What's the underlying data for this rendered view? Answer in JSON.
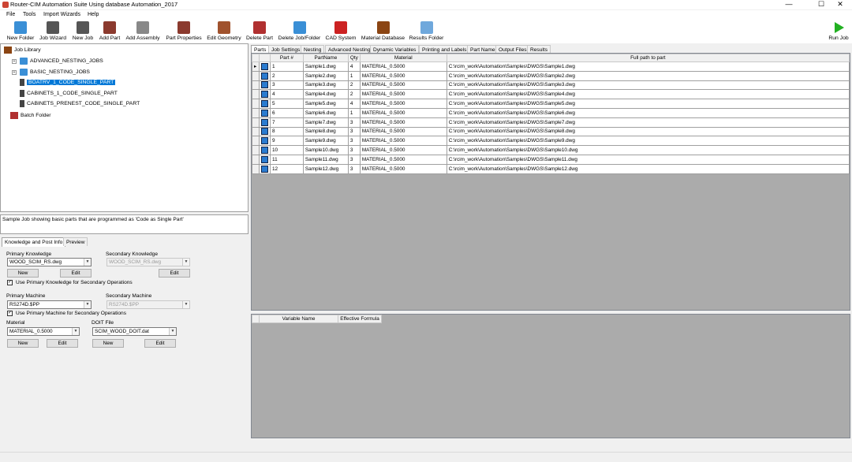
{
  "window": {
    "title": "Router-CIM Automation Suite  Using database Automation_2017",
    "minimize": "—",
    "maximize": "☐",
    "close": "✕"
  },
  "menu": [
    "File",
    "Tools",
    "Import Wizards",
    "Help"
  ],
  "toolbar": {
    "buttons": [
      {
        "label": "New Folder",
        "icon": "new-folder-icon",
        "color": "#3a8fd6"
      },
      {
        "label": "Job Wizard",
        "icon": "job-wizard-icon",
        "color": "#555555"
      },
      {
        "label": "New Job",
        "icon": "new-job-icon",
        "color": "#555555"
      },
      {
        "label": "Add Part",
        "icon": "add-part-icon",
        "color": "#8b3a2e"
      },
      {
        "label": "Add Assembly",
        "icon": "add-assembly-icon",
        "color": "#888888"
      },
      {
        "label": "Part Properties",
        "icon": "part-properties-icon",
        "color": "#8b3a2e"
      },
      {
        "label": "Edit Geometry",
        "icon": "edit-geometry-icon",
        "color": "#a0522d"
      },
      {
        "label": "Delete Part",
        "icon": "delete-part-icon",
        "color": "#b03030"
      },
      {
        "label": "Delete Job/Folder",
        "icon": "delete-job-folder-icon",
        "color": "#3a8fd6"
      },
      {
        "label": "CAD System",
        "icon": "cad-system-icon",
        "color": "#cc2222"
      },
      {
        "label": "Material Database",
        "icon": "material-database-icon",
        "color": "#8b4513"
      },
      {
        "label": "Results Folder",
        "icon": "results-folder-icon",
        "color": "#6fa8dc"
      }
    ],
    "run_job": "Run Job"
  },
  "tree": {
    "root": "Job Library",
    "items": [
      {
        "label": "ADVANCED_NESTING_JOBS",
        "type": "folder"
      },
      {
        "label": "BASIC_NESTING_JOBS",
        "type": "folder"
      },
      {
        "label": "BOATRV_1_CODE_SINGLE_PART",
        "type": "job",
        "selected": true
      },
      {
        "label": "CABINETS_1_CODE_SINGLE_PART",
        "type": "job"
      },
      {
        "label": "CABINETS_PRENEST_CODE_SINGLE_PART",
        "type": "job"
      }
    ],
    "batch": "Batch Folder"
  },
  "description": "Sample Job showing basic parts that are programmed as 'Code as Single Part'",
  "left_tabs": [
    "Knowledge and Post Info",
    "Preview"
  ],
  "knowledge": {
    "primary_label": "Primary Knowledge",
    "primary_value": "WOOD_SCIM_RS.dwg",
    "secondary_label": "Secondary Knowledge",
    "secondary_value": "WOOD_SCIM_RS.dwg",
    "new": "New",
    "edit": "Edit",
    "use_primary_knowledge": "Use Primary Knowledge for Secondary Operations",
    "primary_machine_label": "Primary Machine",
    "primary_machine_value": "RS274D.$PP",
    "secondary_machine_label": "Secondary Machine",
    "secondary_machine_value": "RS274D.$PP",
    "use_primary_machine": "Use Primary Machine for Secondary Operations",
    "material_label": "Material",
    "material_value": "MATERIAL_0.5000",
    "doit_label": "DOIT File",
    "doit_value": "SCIM_WOOD_DOIT.dat",
    "check": "✓"
  },
  "right_tabs": [
    "Parts",
    "Job Settings",
    "Nesting",
    "Advanced Nesting",
    "Dynamic Variables",
    "Printing and Labels",
    "Part Name",
    "Output Files",
    "Results"
  ],
  "parts_grid": {
    "columns": [
      "Part #",
      "PartName",
      "Qty",
      "Material",
      "Full path to part"
    ],
    "rows": [
      [
        "1",
        "Sample1.dwg",
        "4",
        "MATERIAL_0.5000",
        "C:\\rcim_work\\Automation\\Samples\\DWGS\\Sample1.dwg"
      ],
      [
        "2",
        "Sample2.dwg",
        "1",
        "MATERIAL_0.5000",
        "C:\\rcim_work\\Automation\\Samples\\DWGS\\Sample2.dwg"
      ],
      [
        "3",
        "Sample3.dwg",
        "2",
        "MATERIAL_0.5000",
        "C:\\rcim_work\\Automation\\Samples\\DWGS\\Sample3.dwg"
      ],
      [
        "4",
        "Sample4.dwg",
        "2",
        "MATERIAL_0.5000",
        "C:\\rcim_work\\Automation\\Samples\\DWGS\\Sample4.dwg"
      ],
      [
        "5",
        "Sample5.dwg",
        "4",
        "MATERIAL_0.5000",
        "C:\\rcim_work\\Automation\\Samples\\DWGS\\Sample5.dwg"
      ],
      [
        "6",
        "Sample6.dwg",
        "1",
        "MATERIAL_0.5000",
        "C:\\rcim_work\\Automation\\Samples\\DWGS\\Sample6.dwg"
      ],
      [
        "7",
        "Sample7.dwg",
        "3",
        "MATERIAL_0.5000",
        "C:\\rcim_work\\Automation\\Samples\\DWGS\\Sample7.dwg"
      ],
      [
        "8",
        "Sample8.dwg",
        "3",
        "MATERIAL_0.5000",
        "C:\\rcim_work\\Automation\\Samples\\DWGS\\Sample8.dwg"
      ],
      [
        "9",
        "Sample9.dwg",
        "3",
        "MATERIAL_0.5000",
        "C:\\rcim_work\\Automation\\Samples\\DWGS\\Sample9.dwg"
      ],
      [
        "10",
        "Sample10.dwg",
        "3",
        "MATERIAL_0.5000",
        "C:\\rcim_work\\Automation\\Samples\\DWGS\\Sample10.dwg"
      ],
      [
        "11",
        "Sample11.dwg",
        "3",
        "MATERIAL_0.5000",
        "C:\\rcim_work\\Automation\\Samples\\DWGS\\Sample11.dwg"
      ],
      [
        "12",
        "Sample12.dwg",
        "3",
        "MATERIAL_0.5000",
        "C:\\rcim_work\\Automation\\Samples\\DWGS\\Sample12.dwg"
      ]
    ]
  },
  "variables_grid": {
    "columns": [
      "Variable Name",
      "Effective Formula"
    ]
  }
}
